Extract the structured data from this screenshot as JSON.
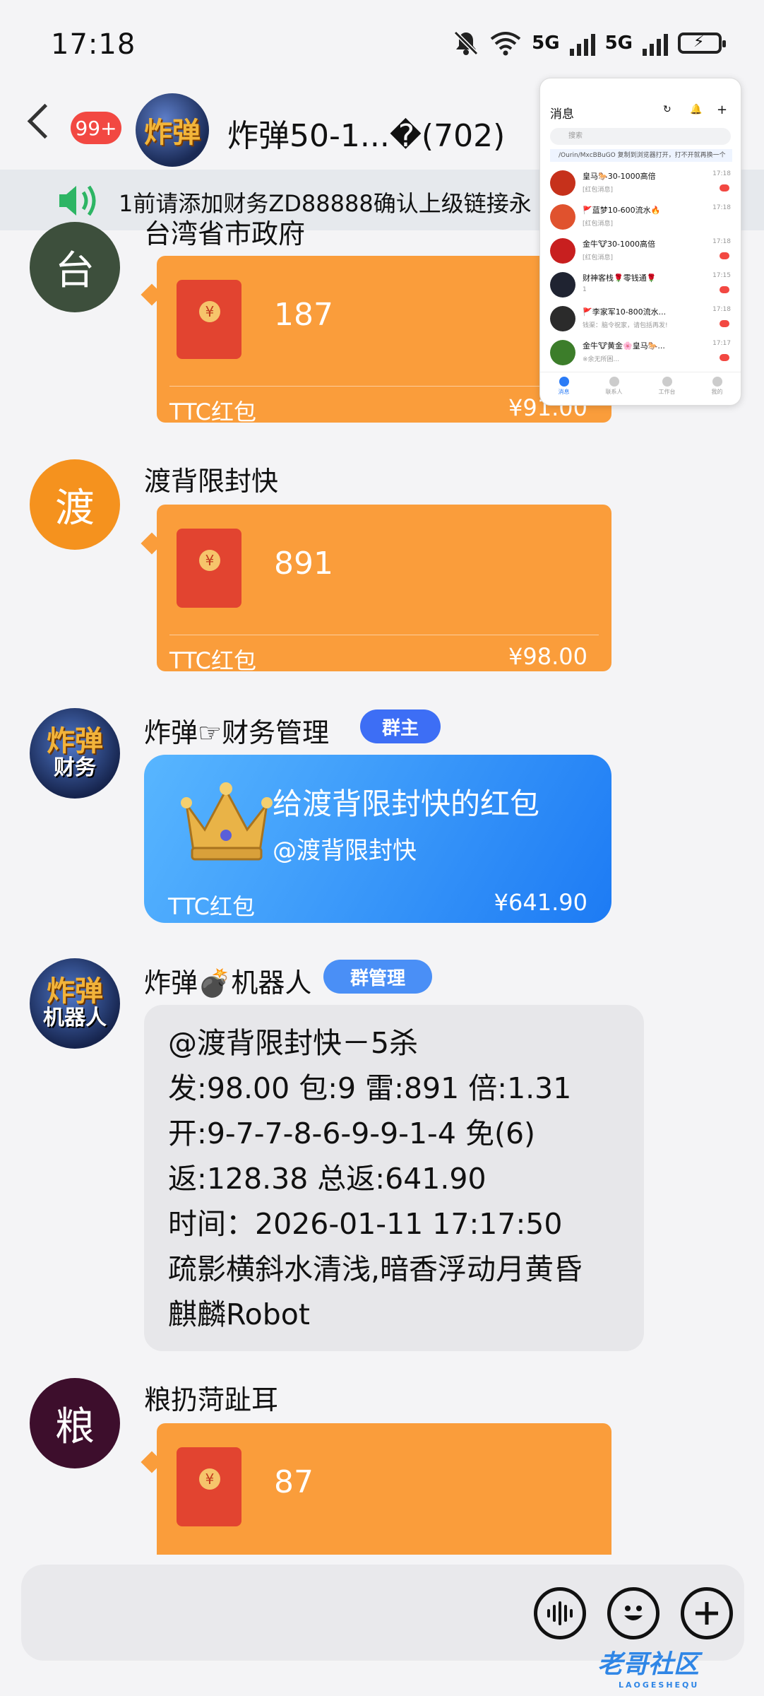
{
  "status_bar": {
    "time": "17:18",
    "net1": "5G",
    "net2": "5G"
  },
  "header": {
    "unread_badge": "99+",
    "avatar_text": "炸弹",
    "title": "炸弹50-1...�(702)"
  },
  "notice": {
    "text": "1前请添加财务ZD88888确认上级链接永"
  },
  "messages": [
    {
      "avatar_text": "台",
      "avatar_color": "#3d4f3c",
      "sender": "台湾省市政府",
      "amount": "187",
      "label": "TTC红包",
      "value": "¥91.00"
    },
    {
      "avatar_text": "渡",
      "avatar_color": "#f5921e",
      "sender": "渡背限封快",
      "amount": "891",
      "label": "TTC红包",
      "value": "¥98.00"
    },
    {
      "avatar_line1": "炸弹",
      "avatar_line2": "财务",
      "sender": "炸弹☞财务管理",
      "role": "群主",
      "role_color": "#3d6ef5",
      "title": "给渡背限封快的红包",
      "subtitle": "@渡背限封快",
      "label": "TTC红包",
      "value": "¥641.90"
    },
    {
      "avatar_line1": "炸弹",
      "avatar_line2": "机器人",
      "sender": "炸弹💣机器人",
      "role": "群管理",
      "role_color": "#4a8ff6",
      "lines": [
        "@渡背限封快－5杀",
        "发:98.00 包:9 雷:891 倍:1.31",
        "开:9-7-7-8-6-9-9-1-4 免(6)",
        "返:128.38 总返:641.90",
        "时间：2026-01-11 17:17:50",
        "疏影横斜水清浅,暗香浮动月黄昏",
        "麒麟Robot"
      ]
    },
    {
      "avatar_text": "粮",
      "avatar_color": "#3d0e2c",
      "sender": "粮扔菏趾耳",
      "amount": "87"
    }
  ],
  "overlay": {
    "title": "消息",
    "search_placeholder": "搜索",
    "banner": "/Ourin/MxcBBuGO 复制到浏览器打开，打不开就再换一个",
    "rows": [
      {
        "name": "皇马🐎30-1000高倍",
        "preview": "[红包消息]",
        "time": "17:18",
        "color": "#c6311b"
      },
      {
        "name": "🚩蓝梦10-600流水🔥",
        "preview": "[红包消息]",
        "time": "17:18",
        "color": "#e0522e"
      },
      {
        "name": "金牛🐮30-1000高倍",
        "preview": "[红包消息]",
        "time": "17:18",
        "color": "#c81f1f"
      },
      {
        "name": "财神客栈🌹零钱通🌹",
        "preview": "1",
        "time": "17:15",
        "color": "#1f2331"
      },
      {
        "name": "🚩李家军10-800流水...",
        "preview": "钱渠：脑令祝家，请包括再发!",
        "time": "17:18",
        "color": "#2b2b2b"
      },
      {
        "name": "金牛🐮黄金🌸皇马🐎...",
        "preview": "※余无所困...",
        "time": "17:17",
        "color": "#3c7d2a"
      }
    ],
    "tabs": [
      "消息",
      "联系人",
      "工作台",
      "我的"
    ]
  },
  "watermark": {
    "text": "老哥社区",
    "sub": "LAOGESHEQU"
  }
}
